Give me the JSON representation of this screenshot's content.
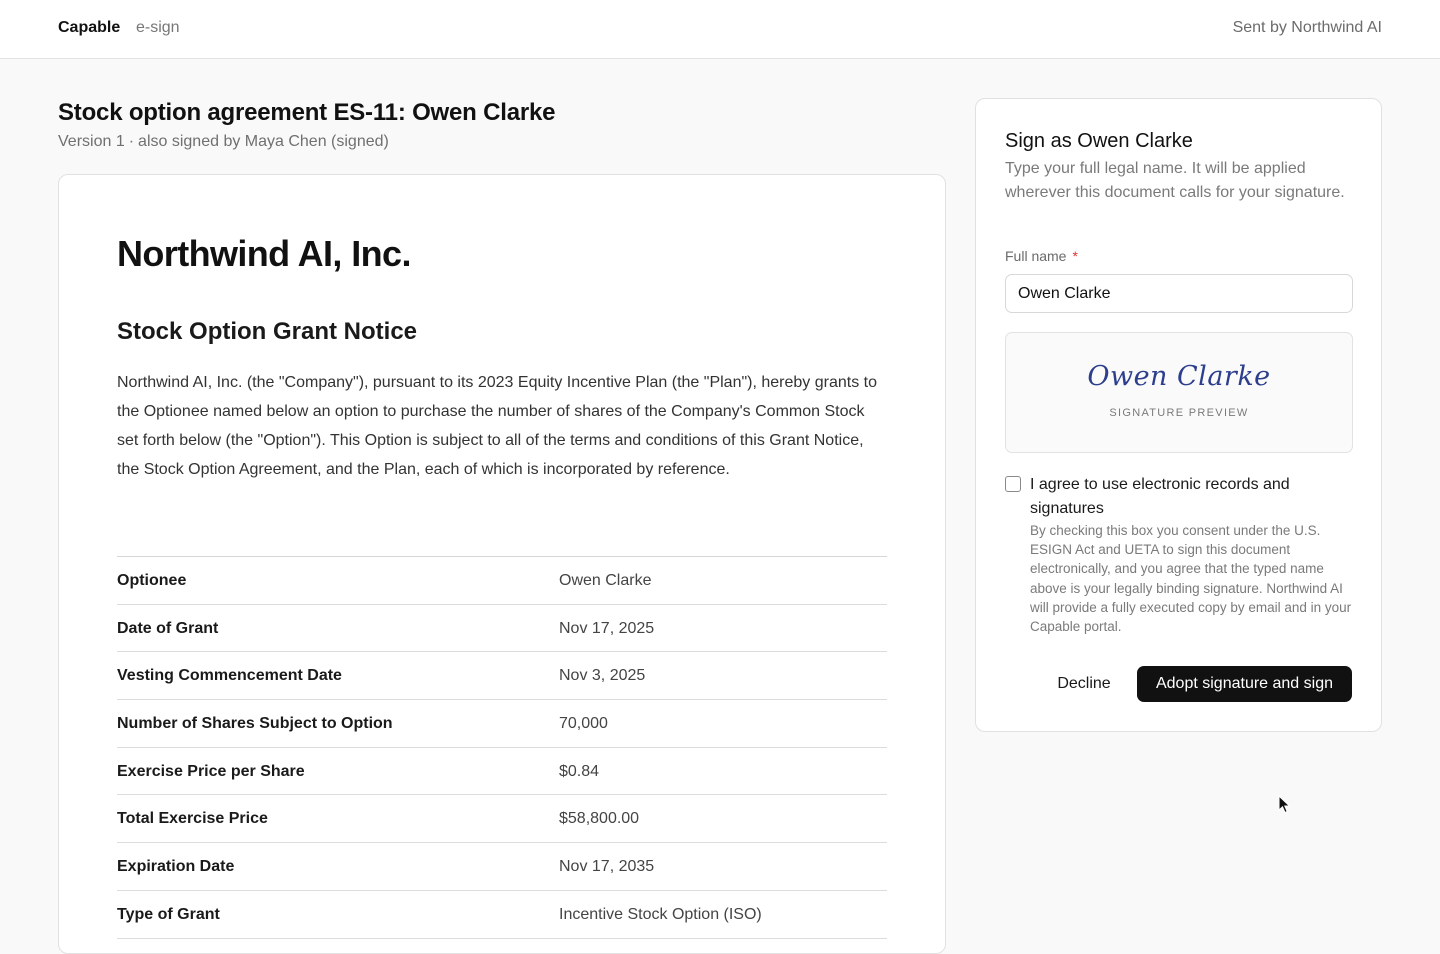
{
  "header": {
    "brand": "Capable",
    "product": "e-sign",
    "sent_by": "Sent by Northwind AI"
  },
  "document": {
    "title": "Stock option agreement ES-11: Owen Clarke",
    "version": "Version 1",
    "separator": "·",
    "also_signed": "also signed by Maya Chen (signed)",
    "company": "Northwind AI, Inc.",
    "notice_title": "Stock Option Grant Notice",
    "body": "Northwind AI, Inc. (the \"Company\"), pursuant to its 2023 Equity Incentive Plan (the \"Plan\"), hereby grants to the Optionee named below an option to purchase the number of shares of the Company's Common Stock set forth below (the \"Option\"). This Option is subject to all of the terms and conditions of this Grant Notice, the Stock Option Agreement, and the Plan, each of which is incorporated by reference.",
    "grant_rows": [
      {
        "label": "Optionee",
        "value": "Owen Clarke"
      },
      {
        "label": "Date of Grant",
        "value": "Nov 17, 2025"
      },
      {
        "label": "Vesting Commencement Date",
        "value": "Nov 3, 2025"
      },
      {
        "label": "Number of Shares Subject to Option",
        "value": "70,000"
      },
      {
        "label": "Exercise Price per Share",
        "value": "$0.84"
      },
      {
        "label": "Total Exercise Price",
        "value": "$58,800.00"
      },
      {
        "label": "Expiration Date",
        "value": "Nov 17, 2035"
      },
      {
        "label": "Type of Grant",
        "value": "Incentive Stock Option (ISO)"
      }
    ]
  },
  "sign_panel": {
    "title": "Sign as Owen Clarke",
    "description": "Type your full legal name. It will be applied wherever this document calls for your signature.",
    "field_label": "Full name",
    "required_mark": "*",
    "full_name_value": "Owen Clarke",
    "preview_signature": "Owen Clarke",
    "preview_caption": "SIGNATURE PREVIEW",
    "consent_checked": false,
    "consent_label": "I agree to use electronic records and signatures",
    "consent_fine": "By checking this box you consent under the U.S. ESIGN Act and UETA to sign this document electronically, and you agree that the typed name above is your legally binding signature. Northwind AI will provide a fully executed copy by email and in your Capable portal.",
    "decline_label": "Decline",
    "adopt_label": "Adopt signature and sign"
  },
  "colors": {
    "primary_button": "#111111",
    "signature_ink": "#2c3e8c",
    "required": "#dd3333"
  },
  "icons": {
    "cursor": "mouse-pointer-icon"
  }
}
